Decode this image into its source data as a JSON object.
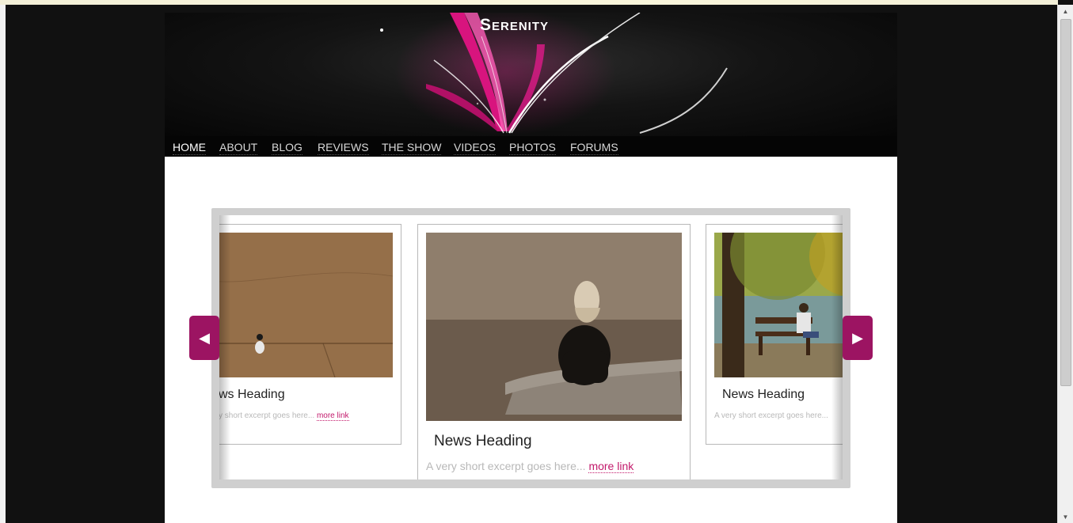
{
  "site": {
    "title": "Serenity"
  },
  "nav": {
    "items": [
      {
        "label": "HOME",
        "active": true
      },
      {
        "label": "ABOUT"
      },
      {
        "label": "BLOG"
      },
      {
        "label": "REVIEWS"
      },
      {
        "label": "THE SHOW"
      },
      {
        "label": "VIDEOS"
      },
      {
        "label": "PHOTOS"
      },
      {
        "label": "FORUMS"
      }
    ]
  },
  "carousel": {
    "prev_icon": "chevron-left-icon",
    "next_icon": "chevron-right-icon",
    "cards": [
      {
        "heading": "ws Heading",
        "excerpt": "y short excerpt goes here...",
        "more": "more link",
        "image": "child-on-floor-photo"
      },
      {
        "heading": "News Heading",
        "excerpt": "A very short excerpt goes here...",
        "more": "more link",
        "image": "woman-on-bench-photo"
      },
      {
        "heading": "News Heading",
        "excerpt": "A very short excerpt goes here...",
        "more": "",
        "image": "man-on-park-bench-photo"
      }
    ]
  },
  "colors": {
    "accent": "#9c1462",
    "link": "#c2196b",
    "background": "#111111"
  }
}
